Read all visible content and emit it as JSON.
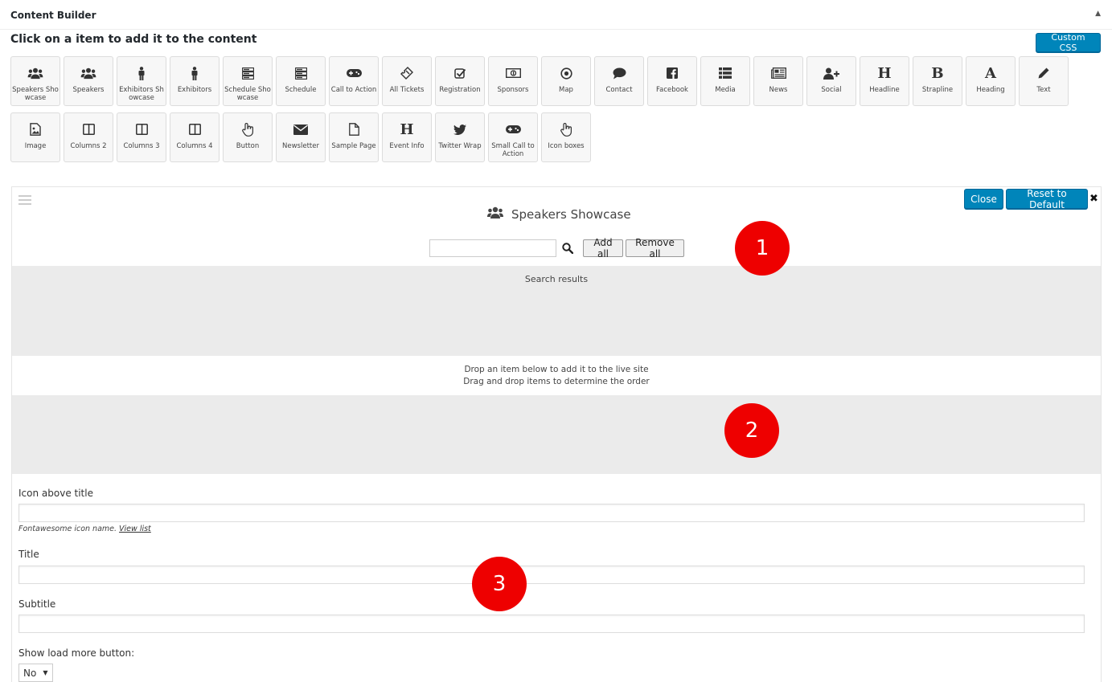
{
  "panel": {
    "title": "Content Builder",
    "collapse_icon": "triangle-up-icon"
  },
  "instruction": "Click on a item to add it to the content",
  "custom_css_label": "Custom CSS",
  "tiles_row1": [
    {
      "label": "Speakers Showcase",
      "icon": "users-icon"
    },
    {
      "label": "Speakers",
      "icon": "users-icon"
    },
    {
      "label": "Exhibitors Showcase",
      "icon": "male-icon"
    },
    {
      "label": "Exhibitors",
      "icon": "male-icon"
    },
    {
      "label": "Schedule Showcase",
      "icon": "server-icon"
    },
    {
      "label": "Schedule",
      "icon": "server-icon"
    },
    {
      "label": "Call to Action",
      "icon": "gamepad-icon"
    },
    {
      "label": "All Tickets",
      "icon": "ticket-icon"
    },
    {
      "label": "Registration",
      "icon": "check-square-icon"
    },
    {
      "label": "Sponsors",
      "icon": "money-icon"
    },
    {
      "label": "Map",
      "icon": "dot-circle-icon"
    },
    {
      "label": "Contact",
      "icon": "comment-icon"
    },
    {
      "label": "Facebook",
      "icon": "facebook-icon"
    },
    {
      "label": "Media",
      "icon": "list-icon"
    },
    {
      "label": "News",
      "icon": "newspaper-icon"
    },
    {
      "label": "Social",
      "icon": "user-plus-icon"
    },
    {
      "label": "Headline",
      "icon": "header-icon",
      "glyph": "H"
    },
    {
      "label": "Strapline",
      "icon": "bold-icon",
      "glyph": "B"
    },
    {
      "label": "Heading",
      "icon": "font-icon",
      "glyph": "A"
    },
    {
      "label": "Text",
      "icon": "pencil-icon"
    }
  ],
  "tiles_row2": [
    {
      "label": "Image",
      "icon": "image-icon"
    },
    {
      "label": "Columns 2",
      "icon": "columns-icon"
    },
    {
      "label": "Columns 3",
      "icon": "columns-icon"
    },
    {
      "label": "Columns 4",
      "icon": "columns-icon"
    },
    {
      "label": "Button",
      "icon": "hand-pointer-icon"
    },
    {
      "label": "Newsletter",
      "icon": "envelope-icon"
    },
    {
      "label": "Sample Page",
      "icon": "file-icon"
    },
    {
      "label": "Event Info",
      "icon": "header-icon",
      "glyph": "H"
    },
    {
      "label": "Twitter Wrap",
      "icon": "twitter-icon"
    },
    {
      "label": "Small Call to Action",
      "icon": "gamepad-icon"
    },
    {
      "label": "Icon boxes",
      "icon": "hand-pointer-icon"
    }
  ],
  "editor": {
    "title": "Speakers Showcase",
    "close_label": "Close",
    "reset_label": "Reset to Default",
    "add_all_label": "Add all",
    "remove_all_label": "Remove all",
    "search_value": "",
    "results_label": "Search results",
    "drop_hint_1": "Drop an item below to add it to the live site",
    "drop_hint_2": "Drag and drop items to determine the order"
  },
  "form": {
    "icon_label": "Icon above title",
    "icon_value": "",
    "icon_help": "Fontawesome icon name.",
    "icon_help_link": "View list",
    "title_label": "Title",
    "title_value": "",
    "subtitle_label": "Subtitle",
    "subtitle_value": "",
    "load_more_label": "Show load more button:",
    "load_more_value": "No"
  },
  "badges": [
    "1",
    "2",
    "3"
  ],
  "colors": {
    "primary": "#0085ba",
    "badge": "#ee0000",
    "area": "#ebebeb"
  }
}
